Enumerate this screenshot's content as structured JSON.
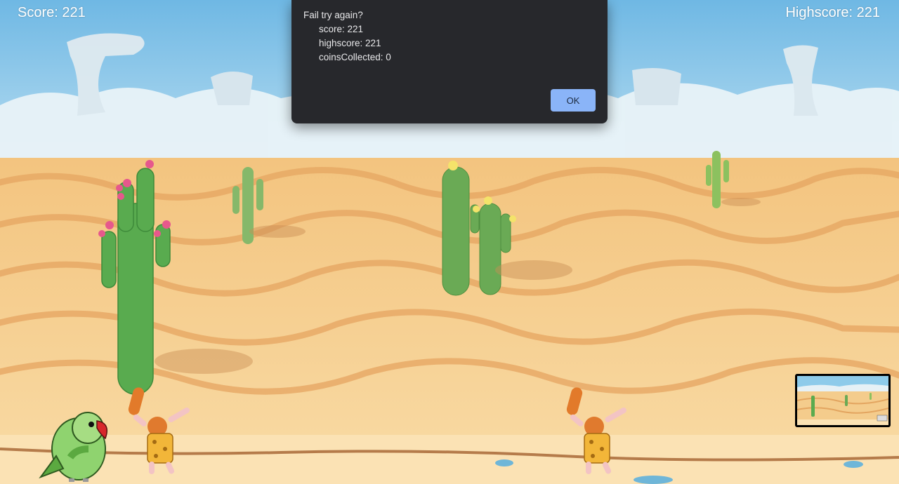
{
  "hud": {
    "score_text": "Score: 221",
    "highscore_text": "Highscore: 221"
  },
  "dialog": {
    "title": "Fail try again?",
    "score_line": "score: 221",
    "highscore_line": "highscore: 221",
    "coins_line": "coinsCollected: 0",
    "ok_label": "OK"
  },
  "colors": {
    "sky": "#7ec3e8",
    "sand": "#f6cd8a",
    "sand_stripe": "#e9a962",
    "cactus": "#5fae4a",
    "dialog_bg": "#27282c",
    "ok_button": "#8ab4f8"
  }
}
